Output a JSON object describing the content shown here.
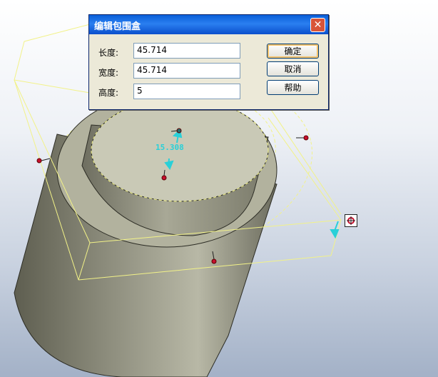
{
  "dialog": {
    "title": "编辑包围盒",
    "close_icon": "close-icon",
    "fields": [
      {
        "label": "长度:",
        "value": "45.714"
      },
      {
        "label": "宽度:",
        "value": "45.714"
      },
      {
        "label": "高度:",
        "value": "5"
      }
    ],
    "buttons": {
      "ok": "确定",
      "cancel": "取消",
      "help": "帮助"
    }
  },
  "viewport": {
    "dimension_label": "15.308",
    "handle_icon": "resize-handle-icon",
    "colors": {
      "bounding_box": "#f2f288",
      "handle_point": "#c8102e",
      "dimension": "#29d0d8",
      "cylinder": "#9a9a86"
    }
  }
}
